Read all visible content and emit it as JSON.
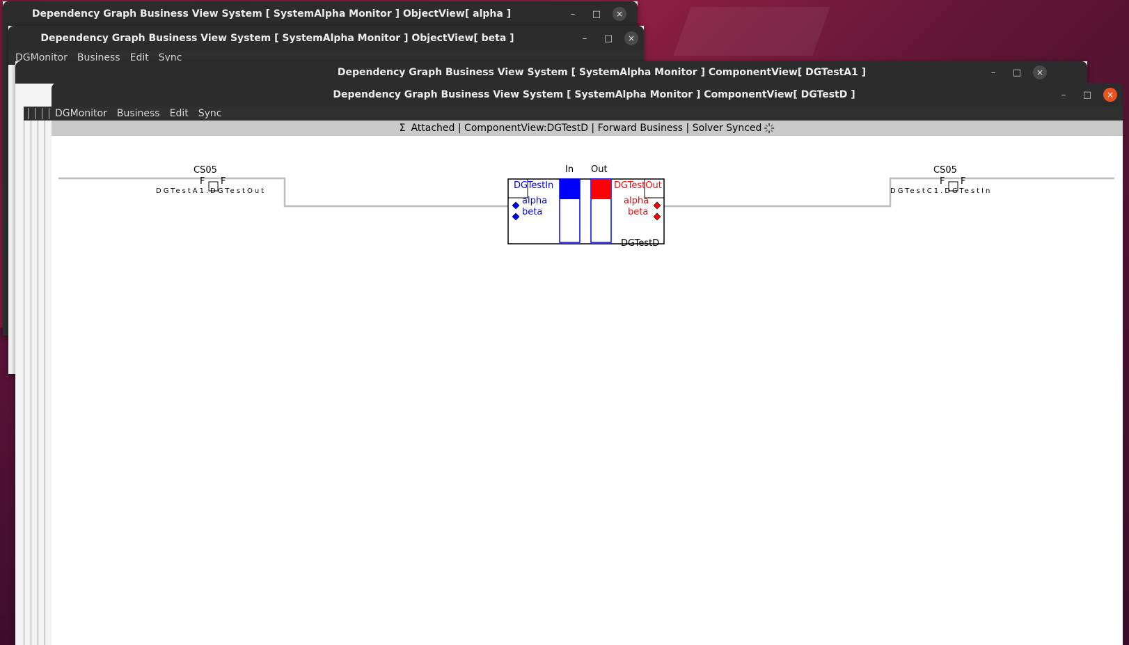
{
  "windows": [
    {
      "title": "Dependency Graph Business View System [ SystemAlpha Monitor ]  ObjectView[ alpha ]"
    },
    {
      "title": "Dependency Graph Business View System [ SystemAlpha Monitor ]  ObjectView[ beta ]"
    },
    {
      "title": "Dependency Graph Business View System [ SystemAlpha Monitor ]  ComponentView[ DGTestA1 ]"
    },
    {
      "title": "Dependency Graph Business View System [ SystemAlpha Monitor ]  ComponentView[ DGTestD ]"
    }
  ],
  "menu": {
    "items": [
      "DGMonitor",
      "Business",
      "Edit",
      "Sync"
    ]
  },
  "window_controls": {
    "minimize": "–",
    "maximize": "□",
    "close": "×"
  },
  "status_bar": {
    "sigma": "Σ",
    "text": "Attached | ComponentView:DGTestD | Forward Business | Solver Synced",
    "spinner_icon": "loading-spinner-icon"
  },
  "graph": {
    "left_node": {
      "name": "CS05",
      "flag_left": "F",
      "flag_right": "F",
      "path": "DGTestA1.DGTestOut"
    },
    "right_node": {
      "name": "CS05",
      "flag_left": "F",
      "flag_right": "F",
      "path": "DGTestC1.DGTestIn"
    },
    "component": {
      "name": "DGTestD",
      "in_label": "In",
      "out_label": "Out",
      "in_port": "DGTestIn",
      "out_port": "DGTestOut",
      "in_objects": [
        "alpha",
        "beta"
      ],
      "out_objects": [
        "alpha",
        "beta"
      ],
      "in_color": "#0000ff",
      "out_color": "#ff0000"
    }
  }
}
